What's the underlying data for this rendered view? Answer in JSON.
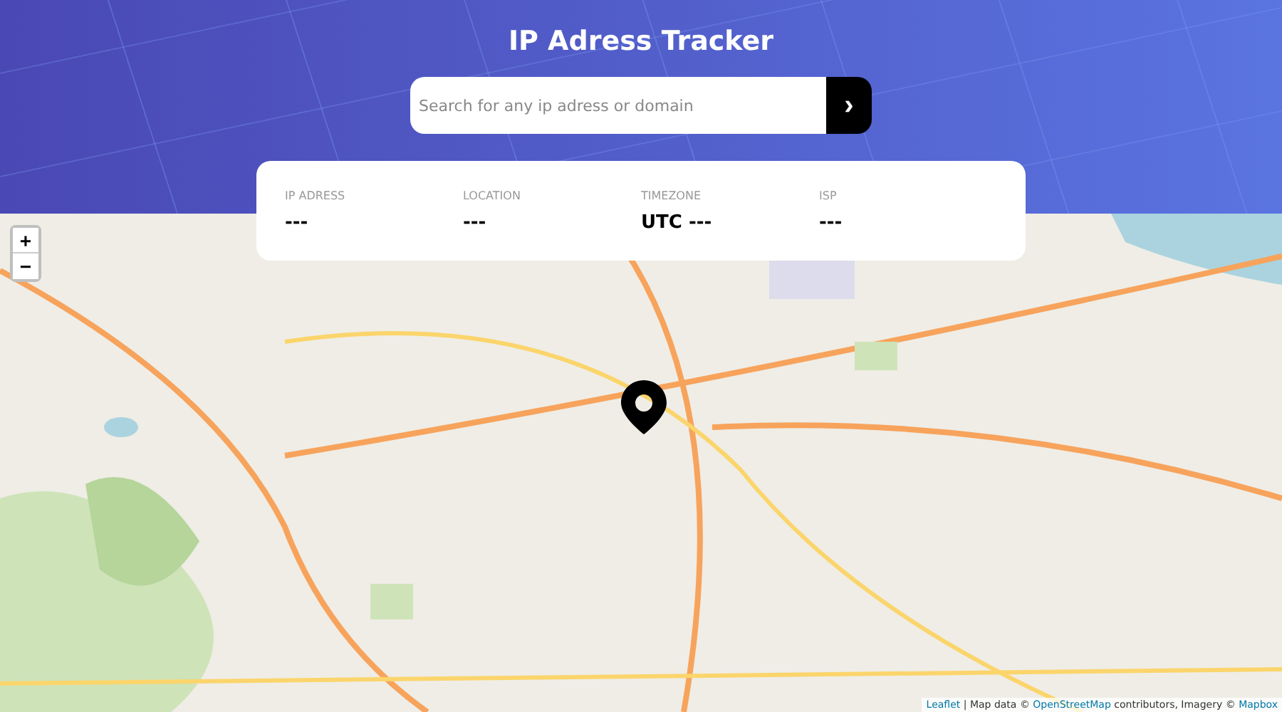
{
  "header": {
    "title": "IP Adress Tracker",
    "search": {
      "placeholder": "Search for any ip adress or domain",
      "button_icon": "›"
    }
  },
  "info": [
    {
      "label": "IP ADRESS",
      "value": "---"
    },
    {
      "label": "LOCATION",
      "value": "---"
    },
    {
      "label": "TIMEZONE",
      "value": "UTC ---"
    },
    {
      "label": "ISP",
      "value": "---"
    }
  ],
  "map": {
    "kind": "picture",
    "zoom_in": "+",
    "zoom_out": "−",
    "attribution": {
      "prefix_link": "Leaflet",
      "text1": " | Map data © ",
      "osm_link": "OpenStreetMap",
      "text2": " contributors, Imagery © ",
      "mapbox_link": "Mapbox"
    }
  }
}
